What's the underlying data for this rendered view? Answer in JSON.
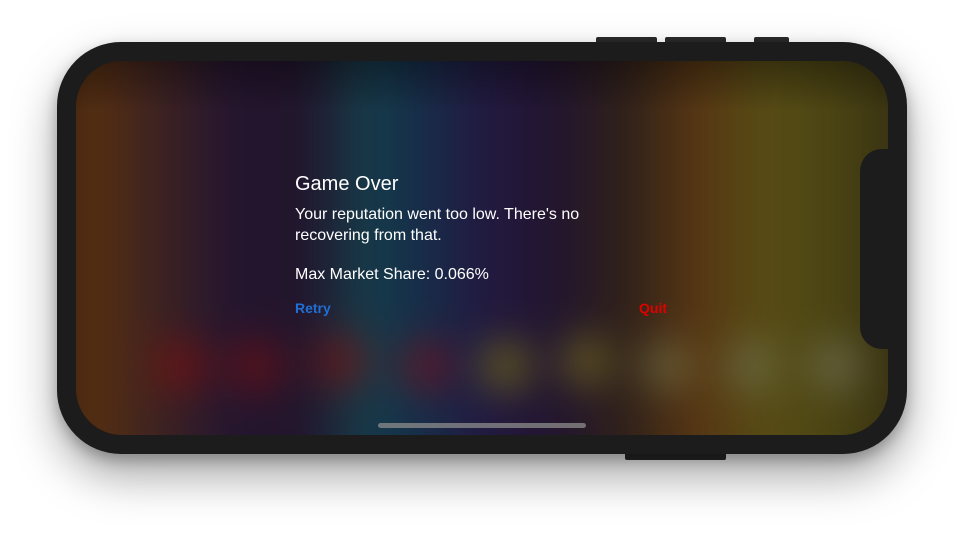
{
  "dialog": {
    "title": "Game Over",
    "message": "Your reputation went too low. There's no recovering from that.",
    "stat_label": "Max Market Share: 0.066%",
    "buttons": {
      "retry": "Retry",
      "quit": "Quit"
    }
  },
  "colors": {
    "retry": "#1f6fd6",
    "quit": "#e00000",
    "text": "#ffffff",
    "device_frame": "#1c1c1c"
  }
}
